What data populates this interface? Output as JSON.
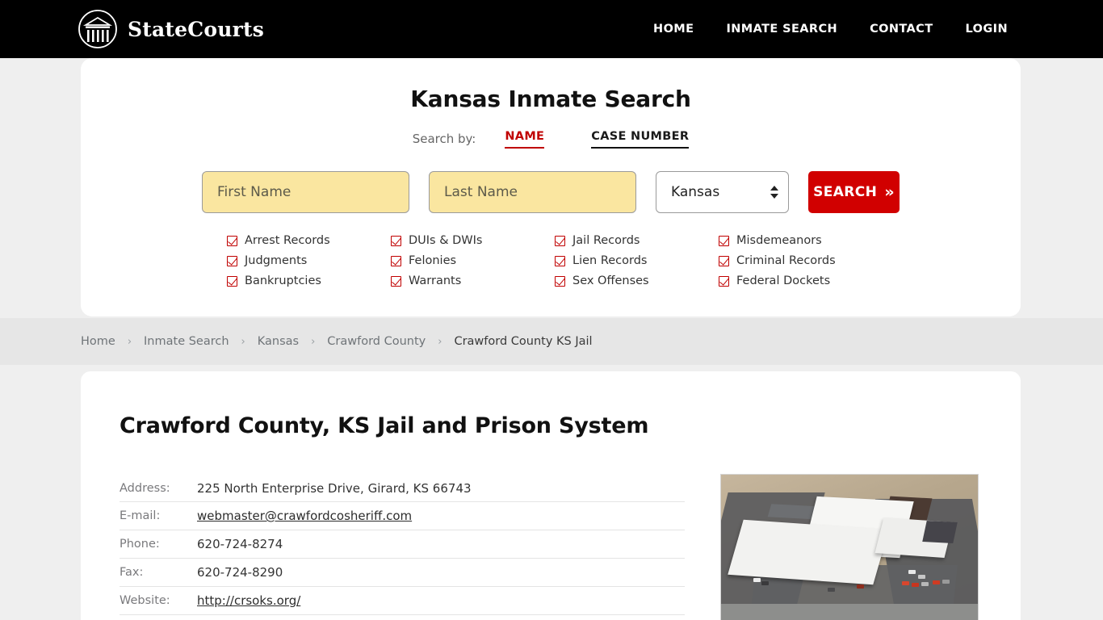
{
  "header": {
    "brand_name": "StateCourts",
    "logo_icon": "courthouse-circle-icon",
    "nav": [
      {
        "label": "HOME"
      },
      {
        "label": "INMATE SEARCH"
      },
      {
        "label": "CONTACT"
      },
      {
        "label": "LOGIN"
      }
    ]
  },
  "search_card": {
    "title": "Kansas Inmate Search",
    "search_by_label": "Search by:",
    "tabs": [
      {
        "label": "NAME",
        "active": true,
        "color": "#c00000"
      },
      {
        "label": "CASE NUMBER",
        "active": false,
        "color": "#1a1a1a"
      }
    ],
    "first_name_placeholder": "First Name",
    "first_name_value": "",
    "last_name_placeholder": "Last Name",
    "last_name_value": "",
    "state_selected": "Kansas",
    "state_icon": "updown-chevron-icon",
    "search_button_label": "SEARCH",
    "search_button_chevron": "»",
    "search_button_color": "#d10000",
    "field_bg_color": "#fae6a0",
    "checkboxes": [
      {
        "label": "Arrest Records",
        "checked": true
      },
      {
        "label": "DUIs & DWIs",
        "checked": true
      },
      {
        "label": "Jail Records",
        "checked": true
      },
      {
        "label": "Misdemeanors",
        "checked": true
      },
      {
        "label": "Judgments",
        "checked": true
      },
      {
        "label": "Felonies",
        "checked": true
      },
      {
        "label": "Lien Records",
        "checked": true
      },
      {
        "label": "Criminal Records",
        "checked": true
      },
      {
        "label": "Bankruptcies",
        "checked": true
      },
      {
        "label": "Warrants",
        "checked": true
      },
      {
        "label": "Sex Offenses",
        "checked": true
      },
      {
        "label": "Federal Dockets",
        "checked": true
      }
    ]
  },
  "breadcrumb": {
    "separator": "›",
    "items": [
      {
        "label": "Home",
        "active": false
      },
      {
        "label": "Inmate Search",
        "active": false
      },
      {
        "label": "Kansas",
        "active": false
      },
      {
        "label": "Crawford County",
        "active": false
      },
      {
        "label": "Crawford County KS Jail",
        "active": true
      }
    ]
  },
  "content": {
    "page_title": "Crawford County, KS Jail and Prison System",
    "info_rows": [
      {
        "label": "Address:",
        "value": "225 North Enterprise Drive, Girard, KS 66743",
        "is_link": false
      },
      {
        "label": "E-mail:",
        "value": "webmaster@crawfordcosheriff.com",
        "is_link": true
      },
      {
        "label": "Phone:",
        "value": "620-724-8274",
        "is_link": false
      },
      {
        "label": "Fax:",
        "value": "620-724-8290",
        "is_link": false
      },
      {
        "label": "Website:",
        "value": "http://crsoks.org/",
        "is_link": true
      }
    ],
    "photo_alt": "aerial-photo-of-crawford-county-jail"
  }
}
